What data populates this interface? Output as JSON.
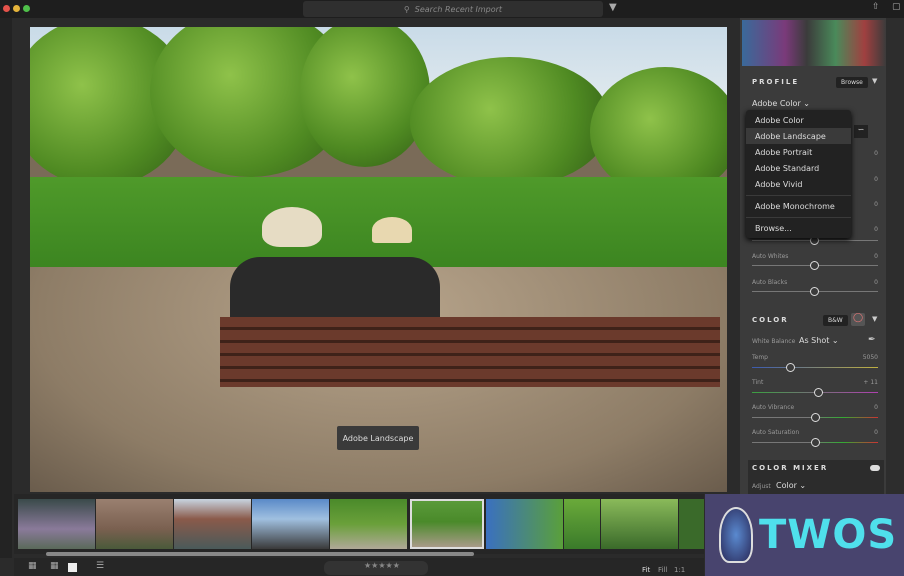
{
  "topbar": {
    "search_placeholder": "Search Recent Import",
    "search_icon": "magnifier",
    "filter_icon": "funnel"
  },
  "photo": {
    "tooltip": "Adobe Landscape"
  },
  "profile": {
    "title": "PROFILE",
    "browse_label": "Browse",
    "current": "Adobe Color",
    "menu": [
      "Adobe Color",
      "Adobe Landscape",
      "Adobe Portrait",
      "Adobe Standard",
      "Adobe Vivid",
      "Adobe Monochrome",
      "Browse..."
    ],
    "highlighted": "Adobe Landscape"
  },
  "light": {
    "hidden_values": [
      "0",
      "0",
      "0",
      "0"
    ],
    "sliders": [
      {
        "label": "Auto Whites",
        "value": "0"
      },
      {
        "label": "Auto Blacks",
        "value": "0"
      }
    ]
  },
  "color": {
    "title": "COLOR",
    "bw_label": "B&W",
    "wb_label": "White Balance",
    "wb_value": "As Shot",
    "sliders": [
      {
        "label": "Temp",
        "value": "5050",
        "pos": 0.3
      },
      {
        "label": "Tint",
        "value": "+ 11",
        "pos": 0.52
      },
      {
        "label": "Auto Vibrance",
        "value": "0",
        "pos": 0.5
      },
      {
        "label": "Auto Saturation",
        "value": "0",
        "pos": 0.5
      }
    ]
  },
  "mixer": {
    "title": "COLOR MIXER",
    "adjust_label": "Adjust",
    "adjust_value": "Color"
  },
  "bottombar": {
    "fit": "Fit",
    "fill": "Fill",
    "one": "1:1",
    "stars": "★★★★★"
  },
  "logo": {
    "text": "TWOS"
  }
}
